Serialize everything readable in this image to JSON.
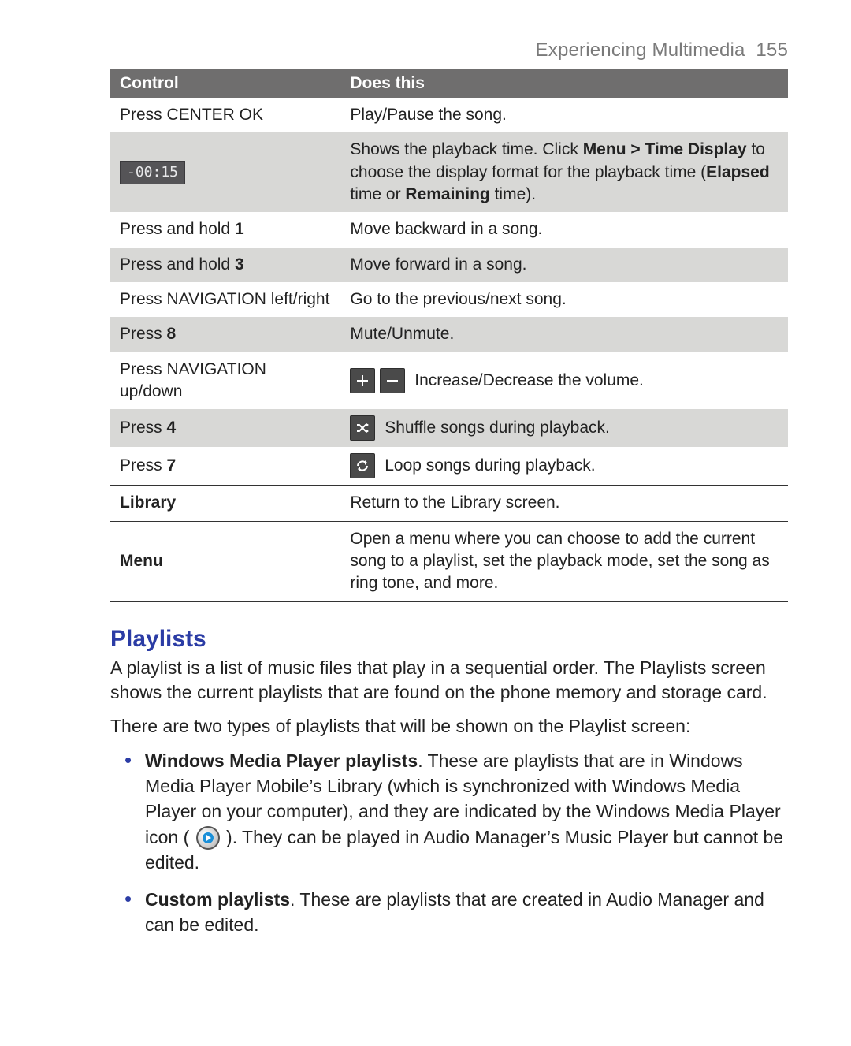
{
  "header": {
    "title": "Experiencing Multimedia",
    "page_no": "155"
  },
  "table": {
    "col1": "Control",
    "col2": "Does this",
    "rows": {
      "r0": {
        "c": "Press CENTER OK",
        "d": "Play/Pause the song."
      },
      "r1": {
        "pill": "-00:15",
        "d_a": "Shows the playback time. Click ",
        "d_b": "Menu > Time Display",
        "d_c": " to choose the display format for the playback time (",
        "d_d": "Elapsed",
        "d_e": " time or ",
        "d_f": "Remaining",
        "d_g": " time)."
      },
      "r2": {
        "c_a": "Press and hold ",
        "c_b": "1",
        "d": "Move backward in a song."
      },
      "r3": {
        "c_a": "Press and hold ",
        "c_b": "3",
        "d": "Move forward in a song."
      },
      "r4": {
        "c": "Press NAVIGATION left/right",
        "d": "Go to the previous/next song."
      },
      "r5": {
        "c_a": "Press ",
        "c_b": "8",
        "d": "Mute/Unmute."
      },
      "r6": {
        "c": "Press NAVIGATION up/down",
        "d": "Increase/Decrease the volume."
      },
      "r7": {
        "c_a": "Press ",
        "c_b": "4",
        "d": "Shuffle songs during playback."
      },
      "r8": {
        "c_a": "Press ",
        "c_b": "7",
        "d": "Loop songs during playback."
      },
      "r9": {
        "c": "Library",
        "d": "Return to the Library screen."
      },
      "r10": {
        "c": "Menu",
        "d": "Open a menu where you can choose to add the current song to a playlist, set the playback mode, set the song as ring tone, and more."
      }
    }
  },
  "section": {
    "title": "Playlists",
    "p1": "A playlist is a list of music files that play in a sequential order. The Playlists screen shows the current playlists that are found on the phone memory and storage card.",
    "p2": "There are two types of playlists that will be shown on the Playlist screen:",
    "li1": {
      "lead": "Windows Media Player playlists",
      "a": ". These are playlists that are in Windows Media Player Mobile’s Library (which is synchronized with Windows Media Player on your computer), and they are indicated by the Windows Media Player icon ( ",
      "b": " ). They can be played in Audio Manager’s Music Player but cannot be edited."
    },
    "li2": {
      "lead": "Custom playlists",
      "a": ". These are playlists that are created in Audio Manager and can be edited."
    }
  }
}
